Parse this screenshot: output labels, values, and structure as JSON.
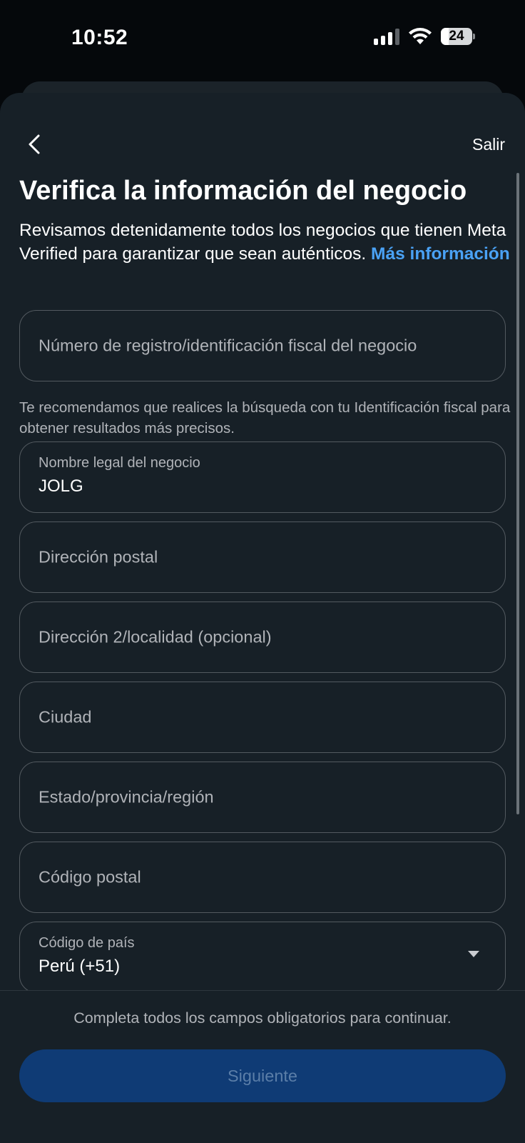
{
  "status_bar": {
    "time": "10:52",
    "battery_level": "24",
    "icons": [
      "cellular-signal-icon",
      "wifi-icon",
      "battery-icon"
    ]
  },
  "nav": {
    "back_icon": "chevron-left-icon",
    "exit_label": "Salir"
  },
  "header": {
    "title": "Verifica la información del negocio",
    "description": "Revisamos detenidamente todos los negocios que tienen Meta Verified para garantizar que sean auténticos.",
    "link_text": "Más información"
  },
  "form": {
    "tax_id": {
      "placeholder": "Número de registro/identificación fiscal del negocio",
      "value": ""
    },
    "tax_id_hint": "Te recomendamos que realices la búsqueda con tu Identificación fiscal para obtener resultados más precisos.",
    "legal_name": {
      "label": "Nombre legal del negocio",
      "value": "JOLG"
    },
    "address": {
      "placeholder": "Dirección postal",
      "value": ""
    },
    "address2": {
      "placeholder": "Dirección 2/localidad (opcional)",
      "value": ""
    },
    "city": {
      "placeholder": "Ciudad",
      "value": ""
    },
    "state": {
      "placeholder": "Estado/provincia/región",
      "value": ""
    },
    "postal_code": {
      "placeholder": "Código postal",
      "value": ""
    },
    "country_code": {
      "label": "Código de país",
      "value": "Perú (+51)"
    }
  },
  "footer": {
    "note": "Completa todos los campos obligatorios para continuar.",
    "next_label": "Siguiente"
  },
  "colors": {
    "background": "#172027",
    "link": "#4aa2f5",
    "button_disabled": "#0f3b75",
    "field_border": "#535a60"
  }
}
